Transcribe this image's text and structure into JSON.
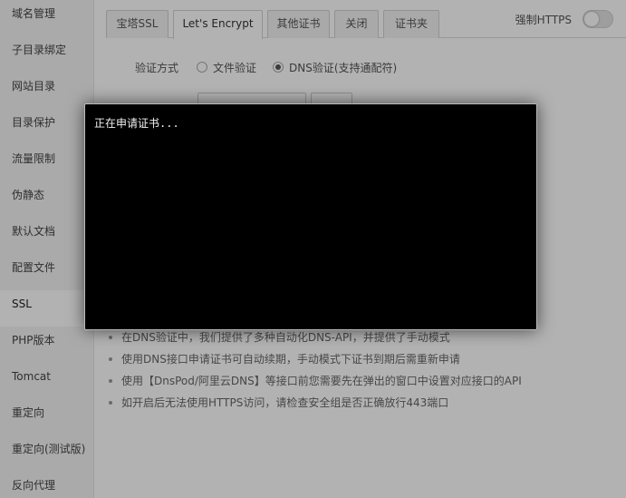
{
  "sidebar": {
    "items": [
      {
        "label": "域名管理"
      },
      {
        "label": "子目录绑定"
      },
      {
        "label": "网站目录"
      },
      {
        "label": "目录保护"
      },
      {
        "label": "流量限制"
      },
      {
        "label": "伪静态"
      },
      {
        "label": "默认文档"
      },
      {
        "label": "配置文件"
      },
      {
        "label": "SSL",
        "active": true
      },
      {
        "label": "PHP版本"
      },
      {
        "label": "Tomcat"
      },
      {
        "label": "重定向"
      },
      {
        "label": "重定向(测试版)"
      },
      {
        "label": "反向代理"
      }
    ]
  },
  "tabs": [
    {
      "label": "宝塔SSL"
    },
    {
      "label": "Let's Encrypt",
      "active": true
    },
    {
      "label": "其他证书"
    },
    {
      "label": "关闭"
    },
    {
      "label": "证书夹"
    }
  ],
  "force_https": {
    "label": "强制HTTPS",
    "enabled": false
  },
  "verify": {
    "label": "验证方式",
    "options": [
      {
        "label": "文件验证",
        "checked": false
      },
      {
        "label": "DNS验证(支持通配符)",
        "checked": true
      }
    ]
  },
  "tips": [
    "在DNS验证中，我们提供了多种自动化DNS-API，并提供了手动模式",
    "使用DNS接口申请证书可自动续期，手动模式下证书到期后需重新申请",
    "使用【DnsPod/阿里云DNS】等接口前您需要先在弹出的窗口中设置对应接口的API",
    "如开启后无法使用HTTPS访问，请检查安全组是否正确放行443端口"
  ],
  "console": {
    "text": "正在申请证书..."
  },
  "colors": {
    "console_bg": "#000000",
    "console_text": "#f0f0f0",
    "sidebar_bg": "#f4f4f4"
  }
}
